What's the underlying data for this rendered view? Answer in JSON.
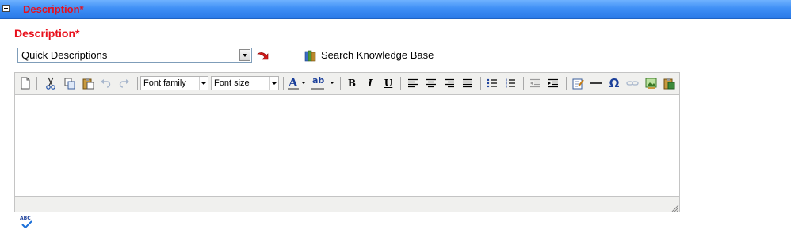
{
  "section": {
    "title": "Description*",
    "toggle_icon": "collapse-icon"
  },
  "field": {
    "label": "Description*"
  },
  "quick_descriptions": {
    "selected": "Quick Descriptions",
    "go_icon": "red-arrow-icon"
  },
  "knowledge_base": {
    "label": "Search Knowledge Base",
    "icon": "books-icon"
  },
  "editor": {
    "font_family": "Font family",
    "font_size": "Font size",
    "bold": "B",
    "italic": "I",
    "underline": "U",
    "text_color_letter": "A",
    "highlight_letters": "ab",
    "special_char": "Ω",
    "text_color": "#1b3f9a",
    "highlight_color": "#ffff33"
  },
  "colors": {
    "header_bar": "#3f8ff5",
    "required_label": "#e8101c",
    "toolbar_bg": "#f0f0ee"
  },
  "spellcheck": {
    "label": "ABC",
    "icon": "spellcheck-icon"
  }
}
